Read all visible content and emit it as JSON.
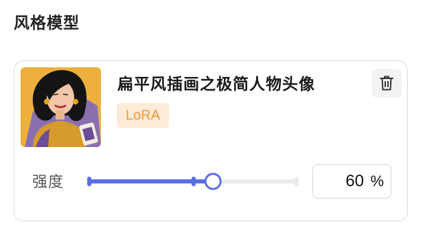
{
  "section": {
    "title": "风格模型"
  },
  "model": {
    "name": "扁平风插画之极简人物头像",
    "tag": "LoRA",
    "thumbnail_icon": "flat-illustration-portrait"
  },
  "strength": {
    "label": "强度",
    "value": "60",
    "unit": "%",
    "fraction": 0.6
  },
  "colors": {
    "slider_active": "#5b6ee6",
    "slider_track": "#e9eaf0",
    "tag_bg": "#fdebd7",
    "tag_text": "#f0993c",
    "delete_bg": "#f2f3f5"
  },
  "icons": {
    "delete": "trash-icon"
  }
}
